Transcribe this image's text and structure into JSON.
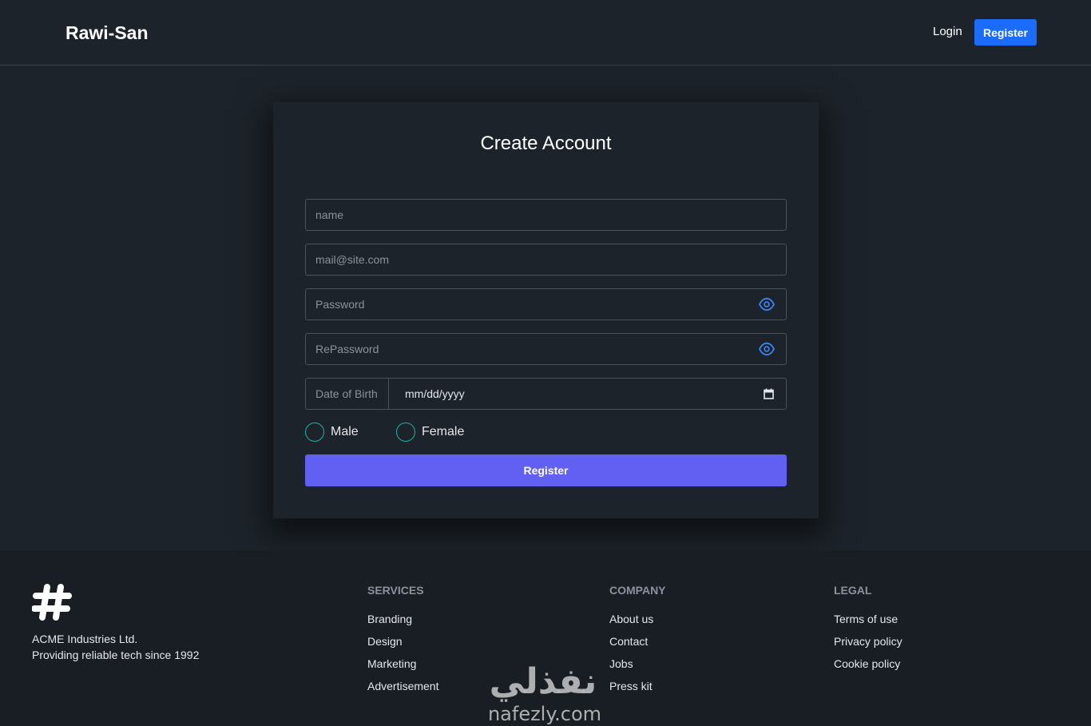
{
  "header": {
    "brand": "Rawi-San",
    "login_label": "Login",
    "register_label": "Register"
  },
  "form": {
    "title": "Create Account",
    "name_placeholder": "name",
    "email_placeholder": "mail@site.com",
    "password_placeholder": "Password",
    "repassword_placeholder": "RePassword",
    "dob_label": "Date of Birth",
    "dob_value": "mm/dd/yyyy",
    "gender_options": [
      "Male",
      "Female"
    ],
    "submit_label": "Register"
  },
  "footer": {
    "company_name": "ACME Industries Ltd.",
    "company_tagline": "Providing reliable tech since 1992",
    "services": {
      "title": "SERVICES",
      "links": [
        "Branding",
        "Design",
        "Marketing",
        "Advertisement"
      ]
    },
    "company": {
      "title": "COMPANY",
      "links": [
        "About us",
        "Contact",
        "Jobs",
        "Press kit"
      ]
    },
    "legal": {
      "title": "LEGAL",
      "links": [
        "Terms of use",
        "Privacy policy",
        "Cookie policy"
      ]
    }
  },
  "watermark": {
    "arabic": "نفذلي",
    "latin": "nafezly.com"
  },
  "colors": {
    "background": "#1d232a",
    "primary_button": "#1b6cfa",
    "submit_button": "#6160f3",
    "radio_accent": "#1fb2a6",
    "eye_icon": "#3b82f6"
  }
}
